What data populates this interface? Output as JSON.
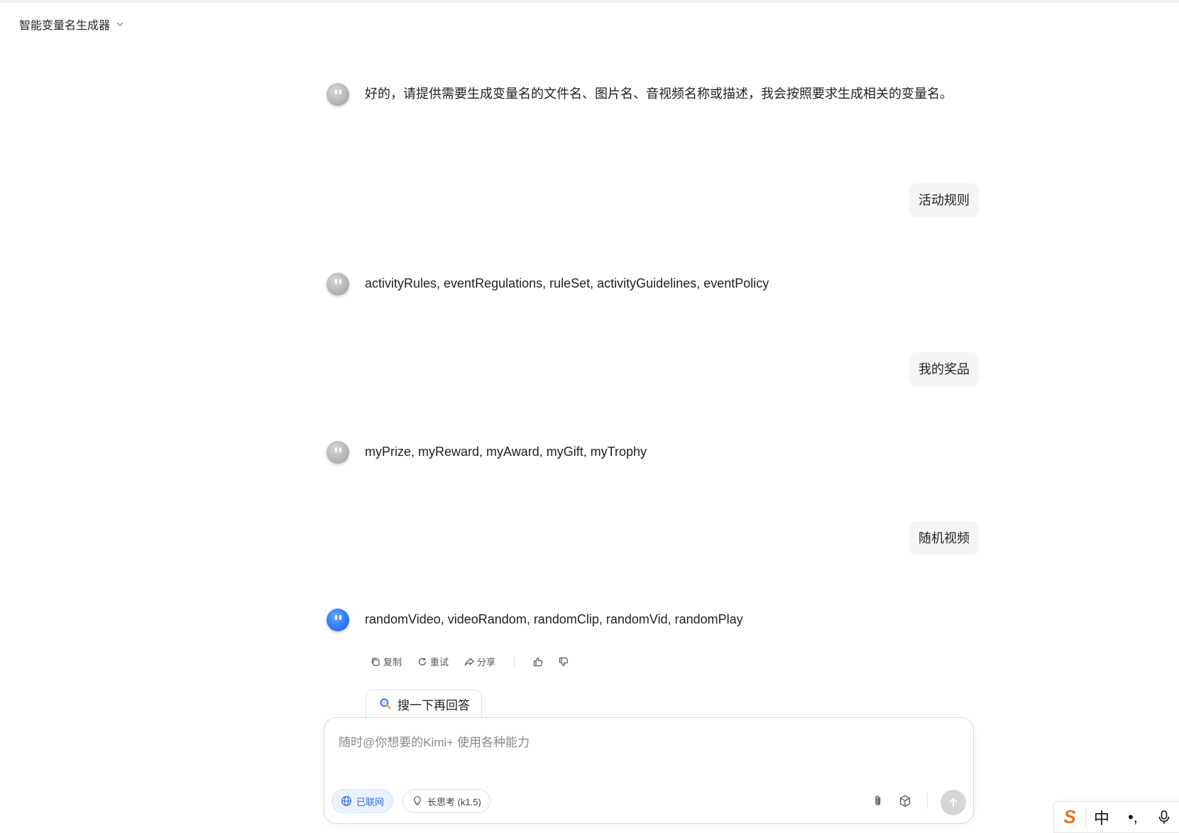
{
  "header": {
    "title": "智能变量名生成器"
  },
  "messages": [
    {
      "role": "bot",
      "text": "好的，请提供需要生成变量名的文件名、图片名、音视频名称或描述，我会按照要求生成相关的变量名。"
    },
    {
      "role": "user",
      "text": "活动规则"
    },
    {
      "role": "bot",
      "text": "activityRules, eventRegulations, ruleSet, activityGuidelines, eventPolicy"
    },
    {
      "role": "user",
      "text": "我的奖品"
    },
    {
      "role": "bot",
      "text": "myPrize, myReward, myAward, myGift, myTrophy"
    },
    {
      "role": "user",
      "text": "随机视频"
    },
    {
      "role": "bot",
      "text": "randomVideo, videoRandom, randomClip, randomVid, randomPlay"
    }
  ],
  "actions": {
    "copy": "复制",
    "retry": "重试",
    "share": "分享"
  },
  "search_again": {
    "label": "搜一下再回答",
    "icon": "magnifier-icon"
  },
  "composer": {
    "placeholder": "随时@你想要的Kimi+ 使用各种能力",
    "value": "",
    "web_toggle": "已联网",
    "think_toggle": "长思考 (k1.5)"
  },
  "ime": {
    "logo": "S",
    "mode": "中",
    "punct": "•,"
  },
  "colors": {
    "accent": "#2f6fe4",
    "user_bubble": "#f5f5f5",
    "ime_logo": "#f06b1d"
  }
}
